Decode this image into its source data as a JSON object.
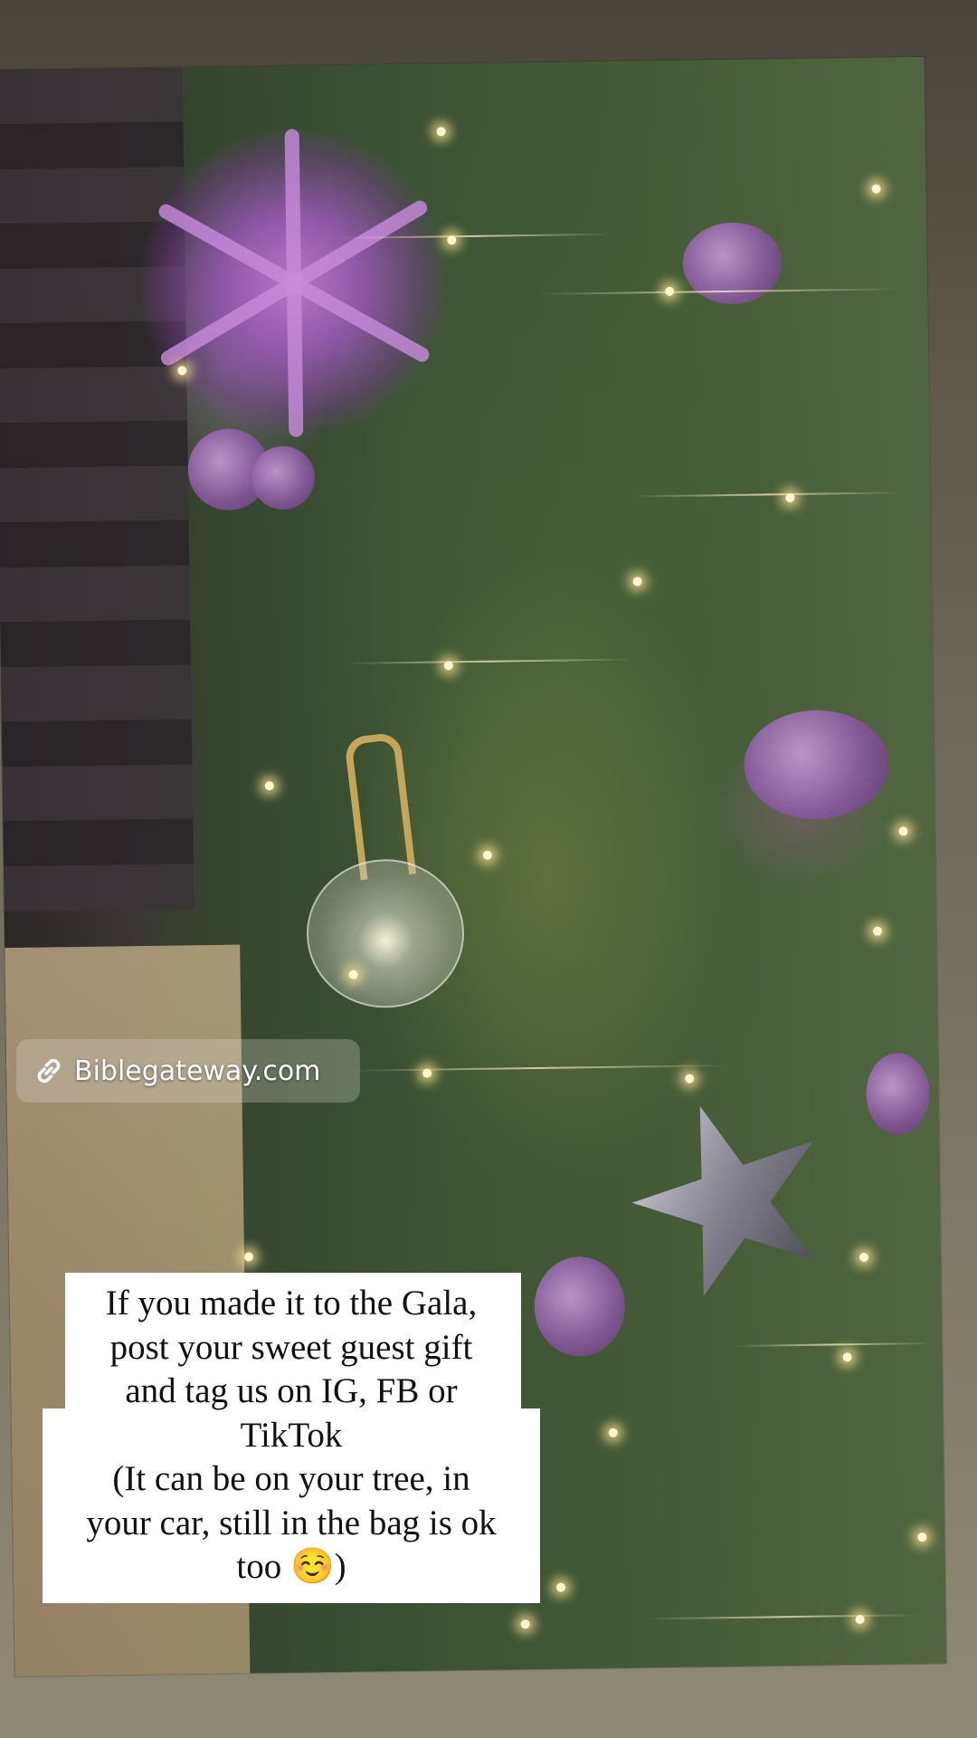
{
  "link_sticker": {
    "icon": "link-icon",
    "text": "Biblegateway.com"
  },
  "caption": {
    "text": "If you made it to the Gala,\npost your sweet guest gift\nand tag us on IG, FB or\nTikTok\n(It can be on your tree, in\nyour car, still in the bag is ok\ntoo ☺️)"
  },
  "colors": {
    "background": "#6f6b5b",
    "caption_bg": "#ffffff",
    "caption_text": "#111111",
    "link_text": "#ffffff"
  }
}
